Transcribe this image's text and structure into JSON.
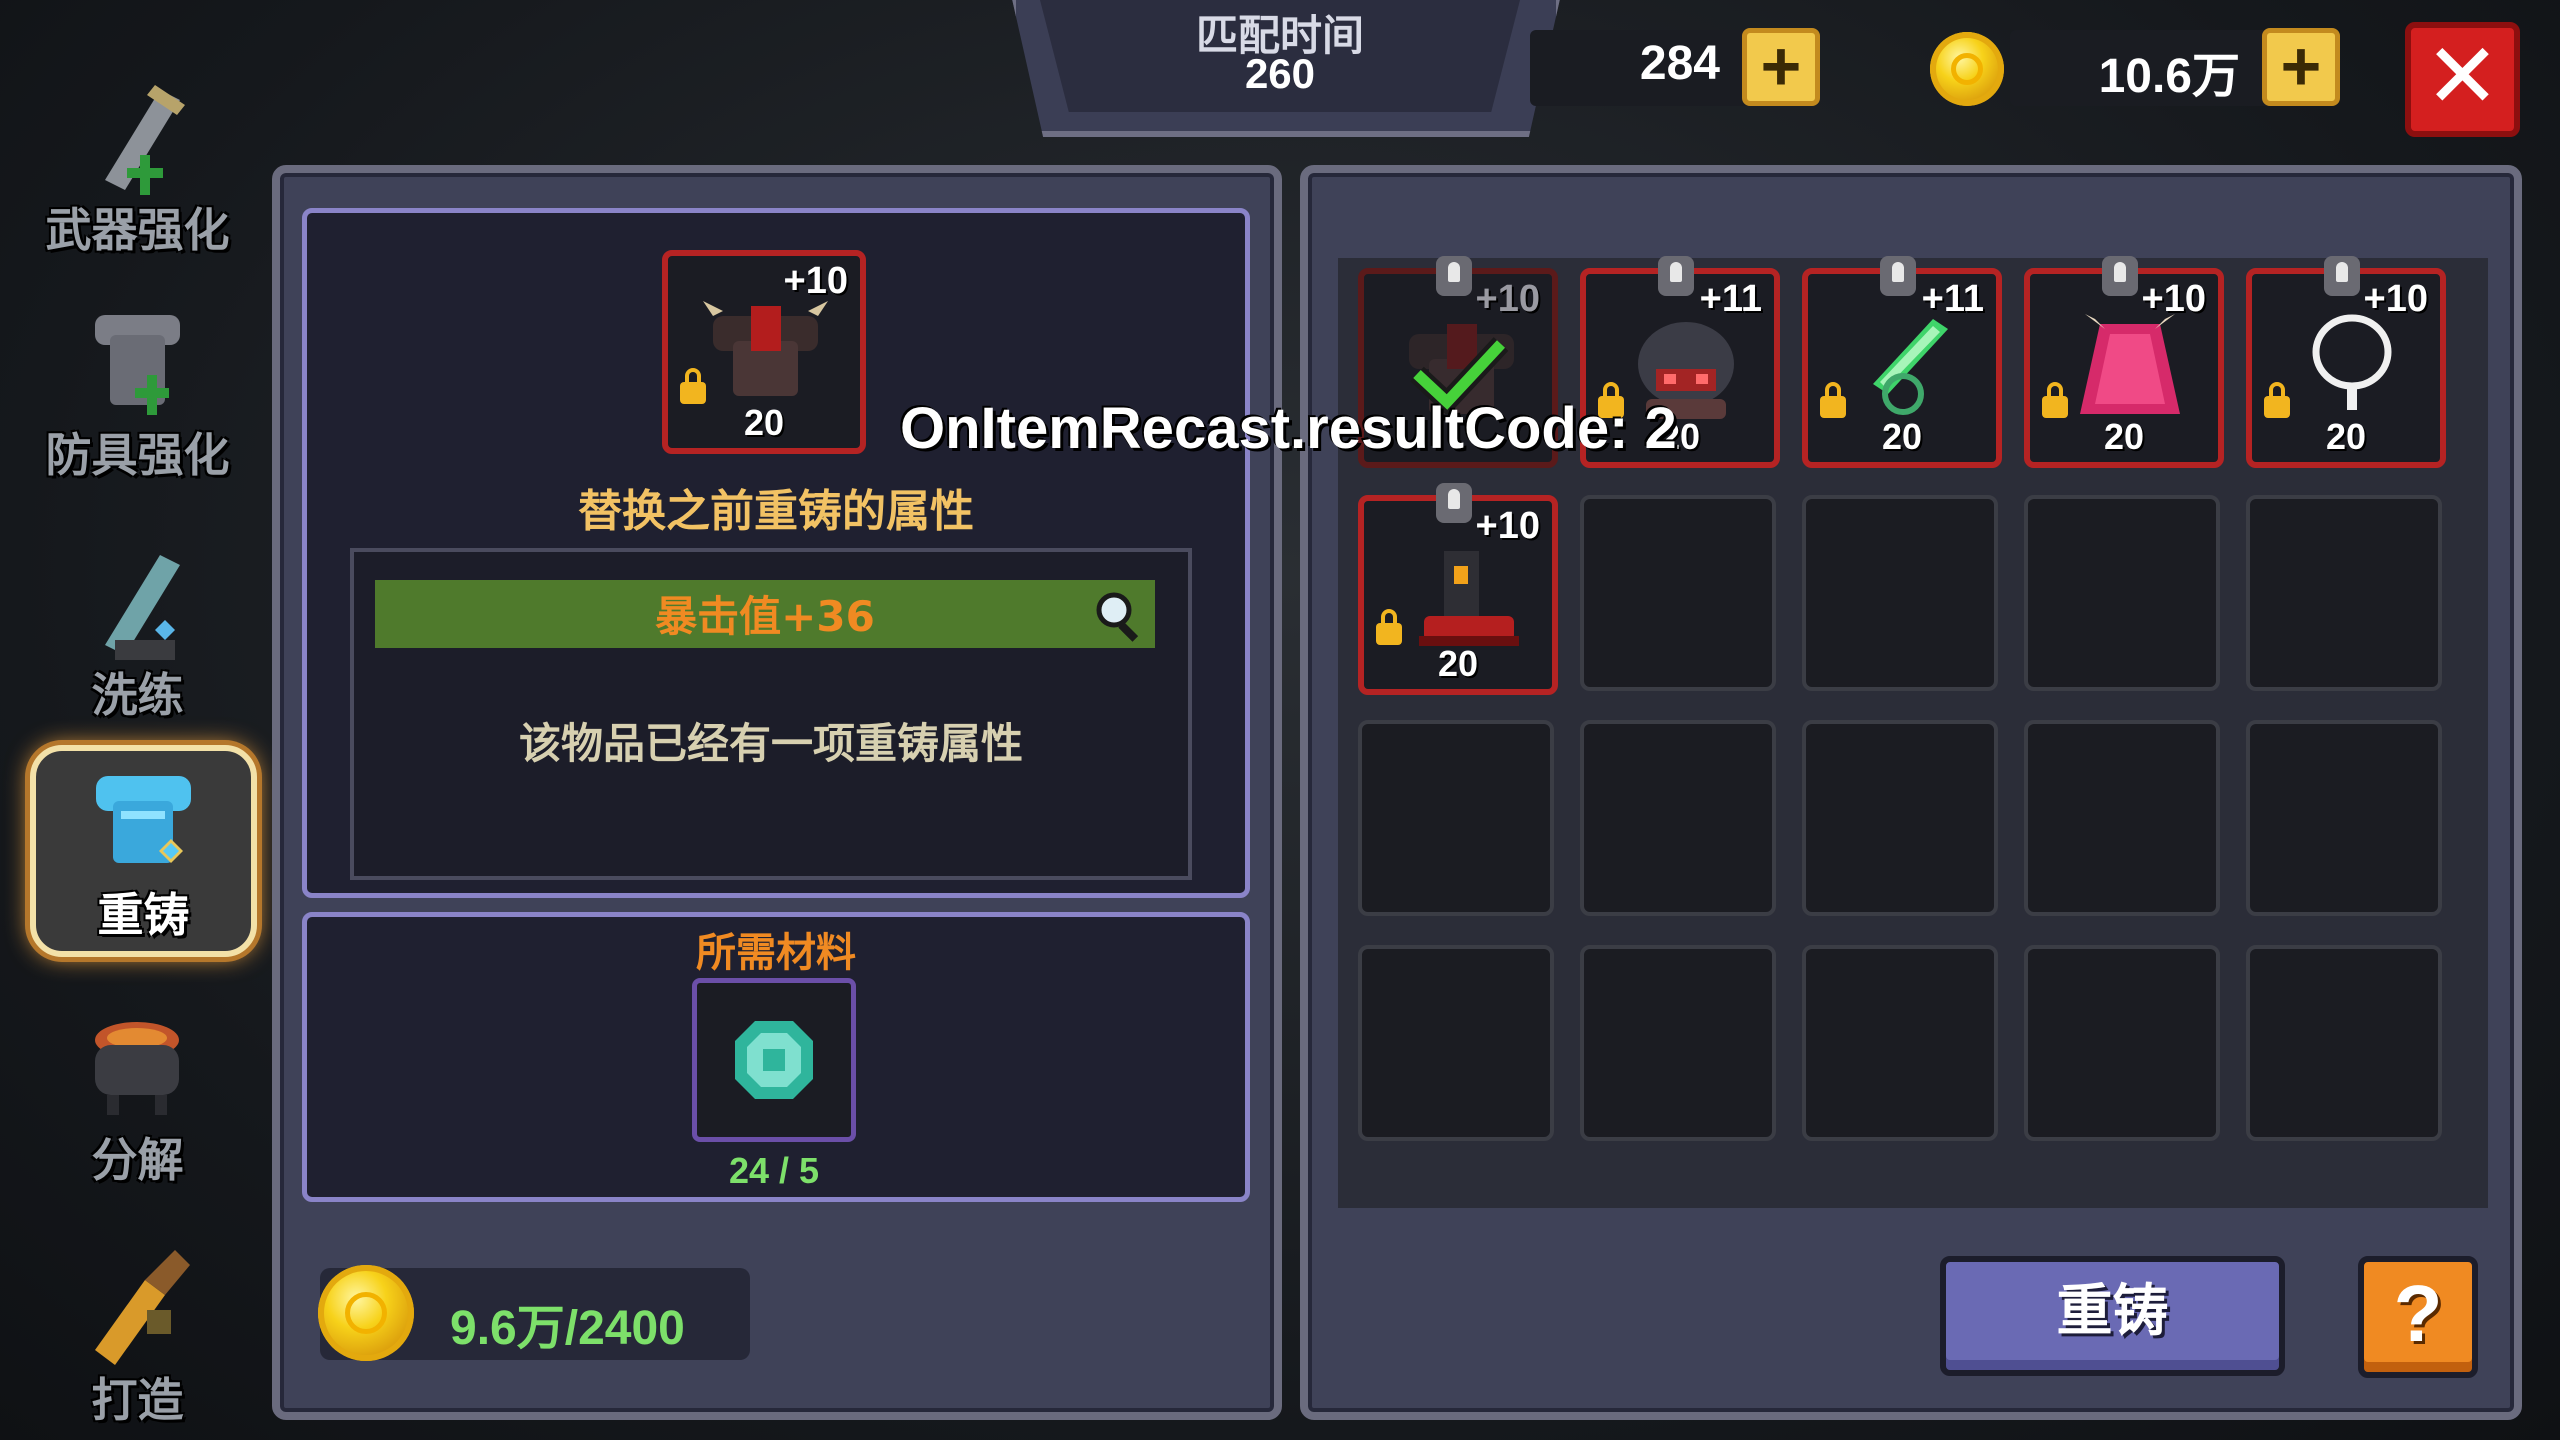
{
  "sidebar": {
    "items": [
      {
        "label": "武器强化",
        "icon": "sword-upgrade-icon"
      },
      {
        "label": "防具强化",
        "icon": "armor-upgrade-icon"
      },
      {
        "label": "洗练",
        "icon": "refine-sword-icon"
      },
      {
        "label": "重铸",
        "icon": "recast-armor-icon",
        "active": true
      },
      {
        "label": "分解",
        "icon": "cauldron-icon"
      },
      {
        "label": "打造",
        "icon": "forge-hammer-icon"
      }
    ]
  },
  "topbar": {
    "match_label": "匹配时间",
    "match_value": "260",
    "gems": "284",
    "gold": "10.6万",
    "plus_symbol": "+",
    "close_symbol": "✕"
  },
  "recast": {
    "item_plus": "+10",
    "item_level": "20",
    "replace_title": "替换之前重铸的属性",
    "attribute": "暴击值+36",
    "notice": "该物品已经有一项重铸属性",
    "materials_title": "所需材料",
    "material_count": "24 / 5",
    "cost": "9.6万/2400"
  },
  "inventory": {
    "items": [
      {
        "plus": "+10",
        "level": "20",
        "icon": "armor-selected-check-icon",
        "selected": true
      },
      {
        "plus": "+11",
        "level": "20",
        "icon": "demon-helmet-icon"
      },
      {
        "plus": "+11",
        "level": "20",
        "icon": "green-blade-icon"
      },
      {
        "plus": "+10",
        "level": "20",
        "icon": "pink-cape-icon"
      },
      {
        "plus": "+10",
        "level": "20",
        "icon": "necklace-icon"
      },
      {
        "plus": "+10",
        "level": "20",
        "icon": "red-boots-icon"
      }
    ],
    "recast_button": "重铸",
    "help_button": "?"
  },
  "debug_overlay": "OnItemRecast.resultCode: 2",
  "colors": {
    "accent_red": "#b52323",
    "attribute_bar": "#4f7a2c",
    "attribute_text": "#f08a22",
    "title_gold": "#f2c264",
    "material_green": "#7de06a"
  }
}
